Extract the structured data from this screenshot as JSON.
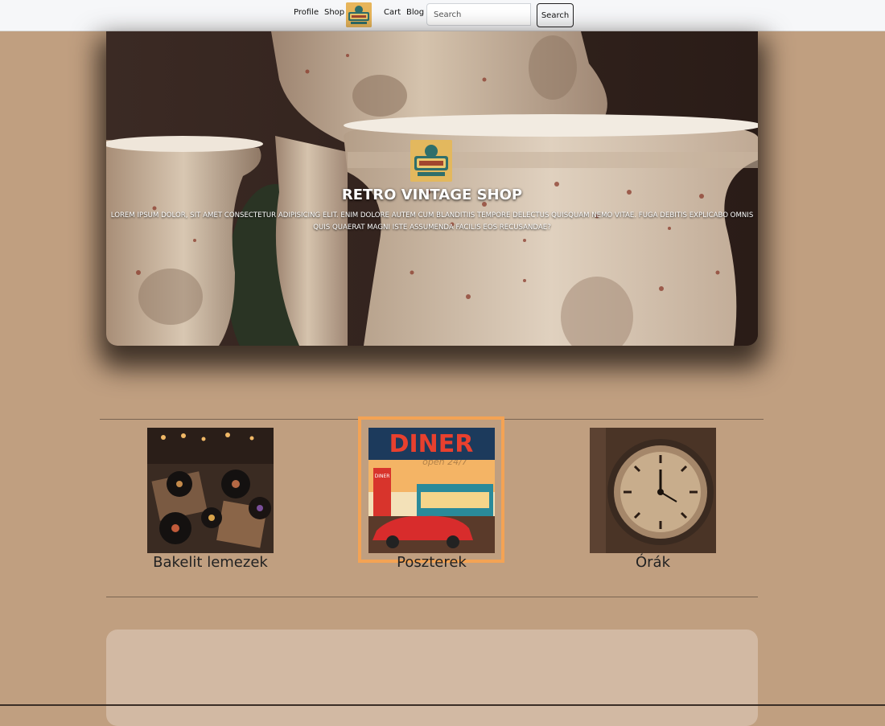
{
  "nav": {
    "profile": "Profile",
    "shop": "Shop",
    "cart": "Cart",
    "blog": "Blog",
    "logo_icon": "retro-logo-icon",
    "search_placeholder": "Search",
    "search_button": "Search"
  },
  "hero": {
    "logo_icon": "retro-logo-icon",
    "title": "RETRO VINTAGE SHOP",
    "text": "Lorem ipsum dolor, sit amet consectetur adipisicing elit. Enim dolore autem cum blanditiis tempore delectus quisquam nemo vitae. Fuga debitis explicabo omnis quis quaerat magni iste assumenda facilis eos recusandae?"
  },
  "categories": [
    {
      "label": "Bakelit lemezek",
      "image_icon": "vinyl-records-image"
    },
    {
      "label": "Poszterek",
      "image_icon": "diner-poster-image",
      "selected": true
    },
    {
      "label": "Órák",
      "image_icon": "wall-clock-image"
    }
  ],
  "colors": {
    "page_bg": "#c09f80",
    "navbar_bg": "#f6f7f9",
    "highlight": "#f4a354",
    "panel_bg": "#d2b9a3",
    "rule": "#7b6552"
  }
}
